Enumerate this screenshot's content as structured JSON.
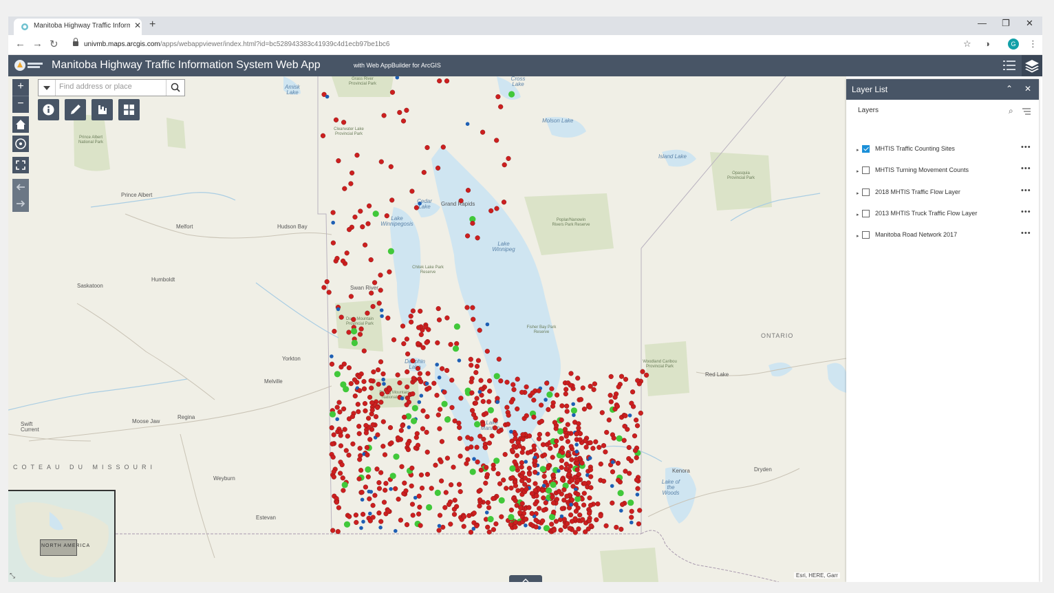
{
  "browser": {
    "tab_title": "Manitoba Highway Traffic Inform",
    "url_host": "univmb.maps.arcgis.com",
    "url_path": "/apps/webappviewer/index.html?id=bc528943383c41939c4d1ecb97be1bc6",
    "profile_initial": "G"
  },
  "app": {
    "title": "Manitoba Highway Traffic Information System Web App",
    "subtitle": "with Web AppBuilder for ArcGIS"
  },
  "search": {
    "placeholder": "Find address or place",
    "value": ""
  },
  "panel": {
    "title": "Layer List",
    "section_title": "Layers",
    "layers": [
      {
        "label": "MHTIS Traffic Counting Sites",
        "checked": true
      },
      {
        "label": "MHTIS Turning Movement Counts",
        "checked": false
      },
      {
        "label": "2018 MHTIS Traffic Flow Layer",
        "checked": false
      },
      {
        "label": "2013 MHTIS Truck Traffic Flow Layer",
        "checked": false
      },
      {
        "label": "Manitoba Road Network 2017",
        "checked": false
      }
    ]
  },
  "map": {
    "attribution": "Esri, HERE, Garr",
    "overview_label": "NORTH AMERICA",
    "colors": {
      "site_red": "#cc1f1f",
      "site_blue": "#1e5fb4",
      "site_green": "#41c83a"
    },
    "places": {
      "prince_albert": "Prince Albert",
      "melfort": "Melfort",
      "hudson_bay": "Hudson Bay",
      "saskatoon": "Saskatoon",
      "humboldt": "Humboldt",
      "yorkton": "Yorkton",
      "melville": "Melville",
      "moose_jaw": "Moose Jaw",
      "regina": "Regina",
      "swift_current": "Swift Current",
      "weyburn": "Weyburn",
      "estevan": "Estevan",
      "grand_rapids": "Grand Rapids",
      "swan_river": "Swan River",
      "red_lake": "Red Lake",
      "kenora": "Kenora",
      "dryden": "Dryden",
      "ontario": "ONTARIO",
      "coteau": "COTEAU DU MISSOURI"
    },
    "water": {
      "lake_winnipeg": "Lake Winnipeg",
      "lake_winnipegosis": "Lake Winnipegosis",
      "cedar_lake": "Cedar Lake",
      "lake_manitoba": "Lake Manitoba",
      "dauphin_lake": "Dauphin Lake",
      "molson_lake": "Molson Lake",
      "island_lake": "Island Lake",
      "lake_of_the_woods": "Lake of the Woods",
      "amisk_lake": "Amisk Lake",
      "cross_lake": "Cross Lake"
    },
    "parks": {
      "prince_albert_np": "Prince Albert National Park",
      "chitek_lake": "Chitek Lake Park Reserve",
      "poplar_nanowin": "Poplar/Nanowin Rivers Park Reserve",
      "duck_mountain": "Duck Mountain Provincial Park",
      "riding_mountain": "Riding Mountain National Park",
      "woodland_caribou": "Woodland Caribou Provincial Park",
      "opasquia": "Opasquia Provincial Park",
      "fisher_bay": "Fisher Bay Park Reserve",
      "clearwater_lake": "Clearwater Lake Provincial Park",
      "grass_river": "Grass River Provincial Park"
    }
  }
}
